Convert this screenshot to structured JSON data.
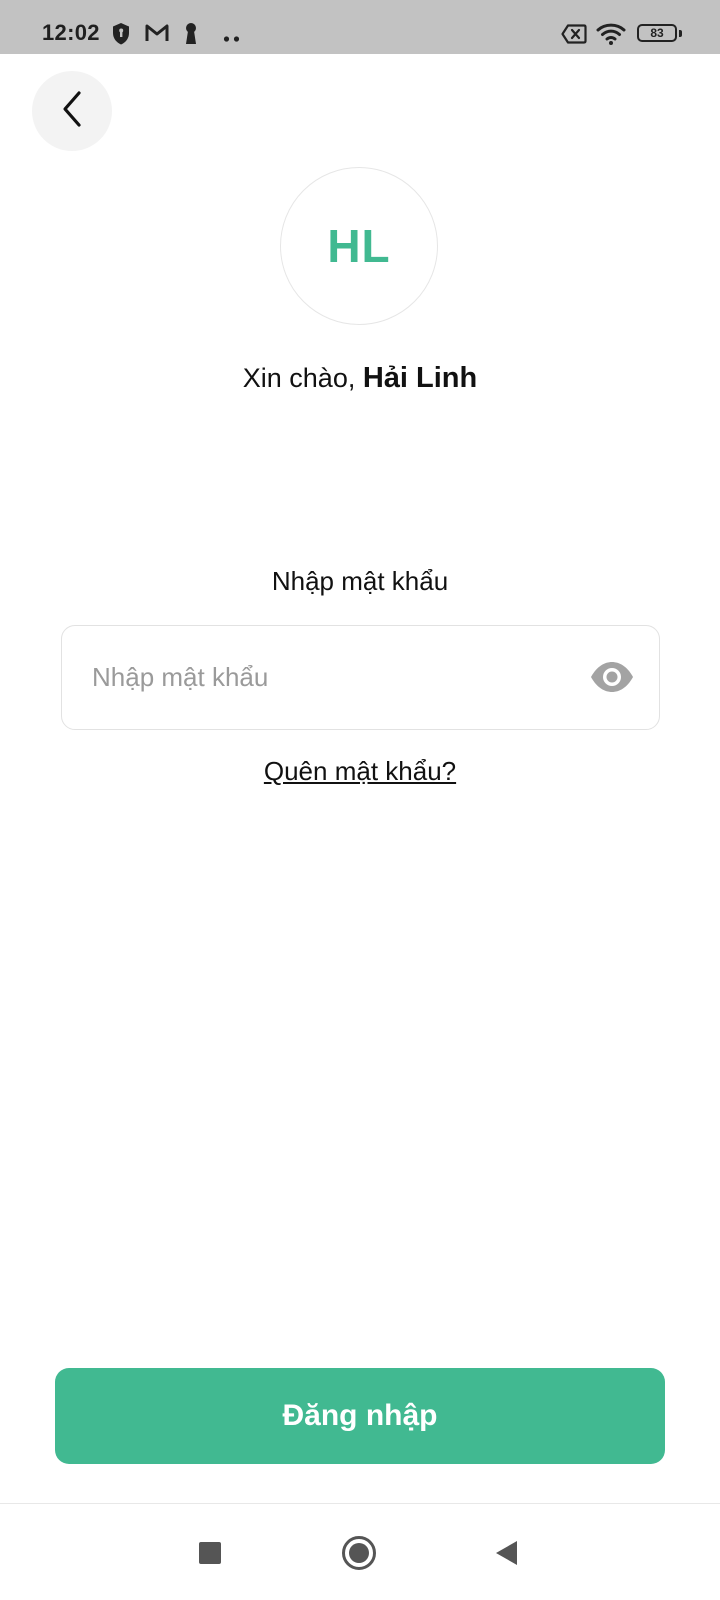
{
  "status_bar": {
    "time": "12:02",
    "battery": "83",
    "icons": [
      "shield-icon",
      "gmail-icon",
      "keyhole-icon",
      "more-dots-icon",
      "sim-off-icon",
      "wifi-icon",
      "battery-icon"
    ]
  },
  "header": {
    "back_icon": "chevron-left-icon"
  },
  "profile": {
    "initials": "HL",
    "greeting_prefix": "Xin chào, ",
    "user_name": "Hải Linh"
  },
  "password": {
    "label": "Nhập mật khẩu",
    "placeholder": "Nhập mật khẩu",
    "value": "",
    "toggle_icon": "eye-icon"
  },
  "forgot_password": "Quên mật khẩu?",
  "login_button": "Đăng nhập",
  "nav_bar": {
    "icons": [
      "recents-square-icon",
      "home-circle-icon",
      "back-triangle-icon"
    ]
  },
  "colors": {
    "accent": "#41b991",
    "status_bar": "#c2c2c2",
    "text": "#111111",
    "placeholder": "#9a9a9a"
  }
}
